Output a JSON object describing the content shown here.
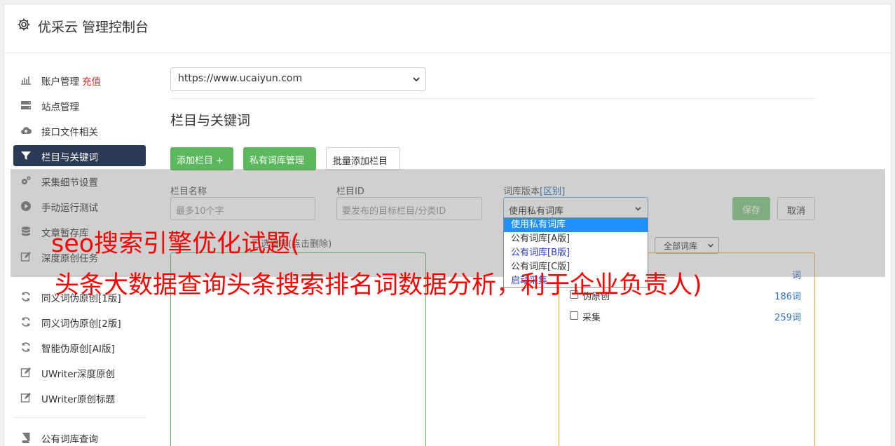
{
  "header": {
    "title": "优采云 管理控制台"
  },
  "sidebar": {
    "items": [
      {
        "label": "账户管理",
        "extra": "充值",
        "icon": "bar-chart-icon"
      },
      {
        "label": "站点管理",
        "icon": "server-icon"
      },
      {
        "label": "接口文件相关",
        "icon": "cloud-upload-icon"
      },
      {
        "label": "栏目与关键词",
        "icon": "filter-icon",
        "active": true
      },
      {
        "label": "采集细节设置",
        "icon": "cogs-icon"
      },
      {
        "label": "手动运行测试",
        "icon": "play-circle-icon"
      },
      {
        "label": "文章暂存库",
        "icon": "database-icon"
      },
      {
        "label": "深度原创任务",
        "icon": "edit-icon"
      },
      {
        "label": "同义词伪原创[1版]",
        "icon": "refresh-icon"
      },
      {
        "label": "同义词伪原创[2版]",
        "icon": "refresh-icon"
      },
      {
        "label": "智能伪原创[AI版]",
        "icon": "refresh-icon"
      },
      {
        "label": "UWriter深度原创",
        "icon": "edit-icon"
      },
      {
        "label": "UWriter原创标题",
        "icon": "edit-icon"
      },
      {
        "label": "公有词库查询",
        "icon": "book-icon"
      }
    ]
  },
  "main": {
    "site_select": "https://www.ucaiyun.com",
    "section_title": "栏目与关键词",
    "buttons": {
      "add_column": "添加栏目 +",
      "private_lib": "私有词库管理",
      "batch_add": "批量添加栏目",
      "save": "保存",
      "cancel": "取消"
    },
    "form": {
      "name_label": "栏目名称",
      "name_placeholder": "最多10个字",
      "id_label": "栏目ID",
      "id_placeholder": "要发布的目标栏目/分类ID",
      "lib_label": "词库版本",
      "lib_label_link": "[区别]",
      "lib_value": "使用私有词库"
    },
    "lib_options": [
      "使用私有词库",
      "公有词库[A版]",
      "公有词库[B版]",
      "公有词库[C版]",
      "启动采集"
    ],
    "selected_hint": "已选词库(点击删除)",
    "lib_filter": "全部词库",
    "libraries": [
      {
        "name": "",
        "count": "词"
      },
      {
        "name": "伪原创",
        "count": "186词"
      },
      {
        "name": "采集",
        "count": "259词"
      }
    ]
  },
  "watermark": {
    "line1": "seo搜索引擎优化试题(",
    "line2": "头条大数据查询头条搜索排名词数据分析，利于企业负责人)"
  },
  "colors": {
    "accent_green": "#5cb85c",
    "active_nav": "#2b3a55",
    "link_blue": "#2a6fc1",
    "watermark_red": "#ff0000"
  }
}
